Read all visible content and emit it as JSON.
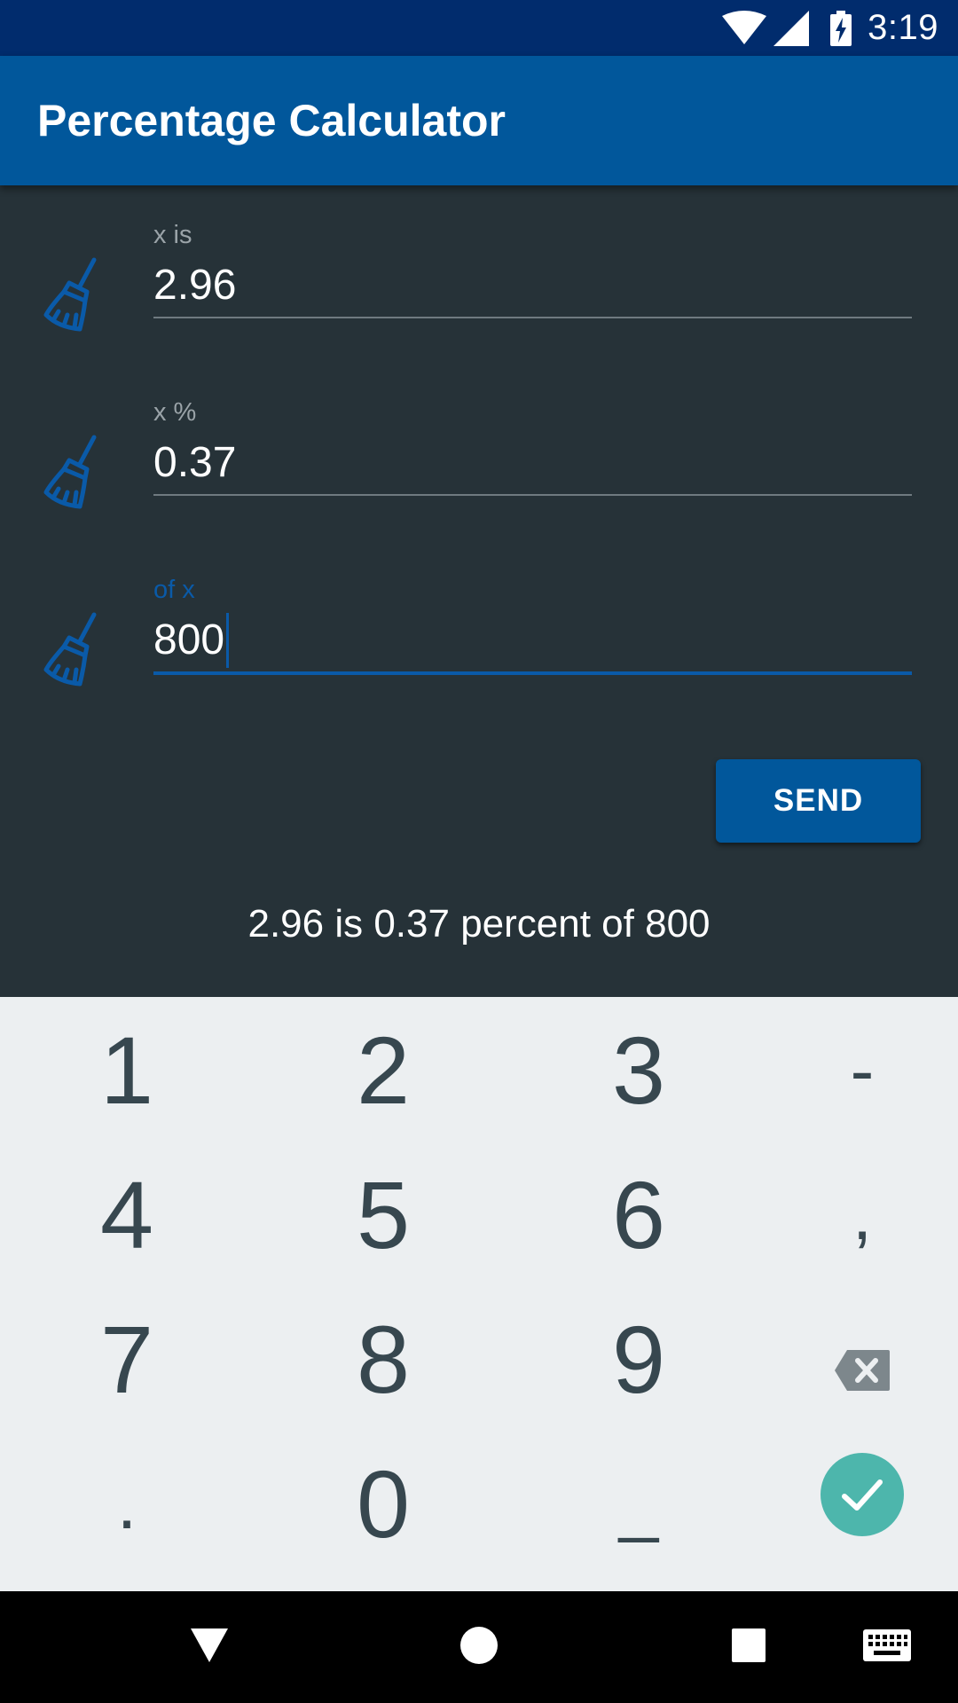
{
  "status_bar": {
    "time": "3:19"
  },
  "app_bar": {
    "title": "Percentage Calculator"
  },
  "fields": [
    {
      "label": "x is",
      "value": "2.96"
    },
    {
      "label": "x %",
      "value": "0.37"
    },
    {
      "label": "of x",
      "value": "800"
    }
  ],
  "send_button": {
    "label": "SEND"
  },
  "result": {
    "text": "2.96 is 0.37 percent of 800"
  },
  "keyboard": {
    "keys": [
      "1",
      "2",
      "3",
      "-",
      "4",
      "5",
      "6",
      ",",
      "7",
      "8",
      "9",
      ".",
      "0"
    ],
    "underscore": "_"
  },
  "colors": {
    "primary": "#01579b",
    "status_bar": "#012c6d",
    "background": "#263238",
    "accent": "#0a5aa8",
    "confirm": "#4db6ac",
    "keyboard_bg": "#eceff1"
  }
}
